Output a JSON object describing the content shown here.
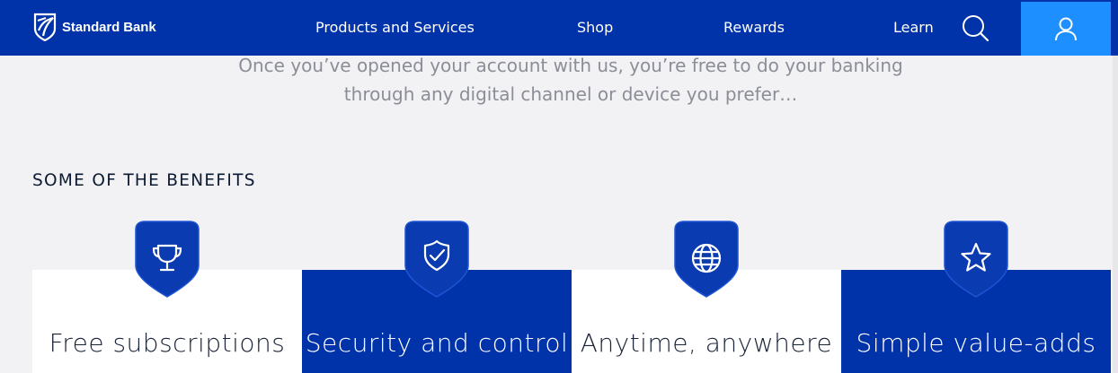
{
  "nav": {
    "brand": "Standard Bank",
    "items": [
      {
        "label": "Products and Services"
      },
      {
        "label": "Shop"
      },
      {
        "label": "Rewards"
      },
      {
        "label": "Learn"
      }
    ],
    "search_icon": "search-icon",
    "account_icon": "user-icon",
    "colors": {
      "bar": "#0033aa",
      "account_button": "#1e8fff"
    }
  },
  "intro": {
    "line1": "Once you’ve opened your account with us, you’re free to do your banking",
    "line2": "through any digital channel or device you prefer…"
  },
  "benefits": {
    "heading": "SOME OF THE BENEFITS",
    "items": [
      {
        "label": "Free subscriptions",
        "icon": "trophy-icon",
        "theme": "light"
      },
      {
        "label": "Security and control",
        "icon": "shield-check-icon",
        "theme": "dark"
      },
      {
        "label": "Anytime, anywhere",
        "icon": "globe-icon",
        "theme": "light"
      },
      {
        "label": "Simple value-adds",
        "icon": "star-icon",
        "theme": "dark"
      }
    ]
  }
}
